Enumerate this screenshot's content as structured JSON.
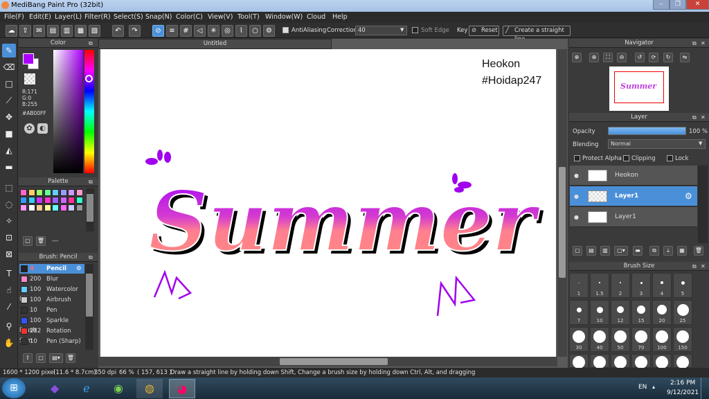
{
  "window": {
    "title": "MediBang Paint Pro (32bit)"
  },
  "menu": [
    "File(F)",
    "Edit(E)",
    "Layer(L)",
    "Filter(R)",
    "Select(S)",
    "Snap(N)",
    "Color(C)",
    "View(V)",
    "Tool(T)",
    "Window(W)",
    "Cloud",
    "Help"
  ],
  "toolbar": {
    "antialiasing": "AntiAliasing",
    "correction_label": "Correction",
    "correction_value": "40",
    "soft_edge": "Soft Edge",
    "key_label": "Key",
    "reset": "Reset",
    "straight_line": "Create a straight line"
  },
  "color_panel": {
    "title": "Color",
    "r": "R:171",
    "g": "G:0",
    "b": "B:255",
    "hex": "#AB00FF",
    "primary": "#AB00FF"
  },
  "palette_panel": {
    "title": "Palette",
    "swatches": [
      "#ff66cc",
      "#ffcc66",
      "#99ff66",
      "#66ff99",
      "#66ccff",
      "#9999ff",
      "#cc99ff",
      "#ff99cc",
      "#3399ff",
      "#33ccff",
      "#cc33ff",
      "#ff33cc",
      "#9966ff",
      "#cc66ff",
      "#ff3399",
      "#33ffcc",
      "#ff99ff",
      "#ffffff",
      "#ffcc99",
      "#ffff99",
      "#66ffff",
      "#ff66ff",
      "#ccccff",
      "#999999"
    ],
    "dash": "---"
  },
  "brush_panel": {
    "title": "Brush: Pencil",
    "items": [
      {
        "size": "4",
        "name": "Pencil",
        "color": "#222222",
        "selected": true
      },
      {
        "size": "200",
        "name": "Blur",
        "color": "#ff88cc"
      },
      {
        "size": "100",
        "name": "Watercolor (W",
        "color": "#66ccff"
      },
      {
        "size": "100",
        "name": "Airbrush",
        "color": "#cccccc"
      },
      {
        "size": "10",
        "name": "Pen",
        "color": "#333333"
      },
      {
        "size": "100",
        "name": "Sparkle Brush",
        "color": "#3355ff"
      },
      {
        "size": "282",
        "name": "Rotation Sym",
        "color": "#ee3333"
      },
      {
        "size": "10",
        "name": "Pen (Sharp)",
        "color": "#333333"
      }
    ]
  },
  "canvas": {
    "tab": "Untitled",
    "text1": "Heokon",
    "text2": "#Hoidap247",
    "art_word": "Summer"
  },
  "navigator": {
    "title": "Navigator"
  },
  "layer_panel": {
    "title": "Layer",
    "opacity_label": "Opacity",
    "opacity_value": "100 %",
    "opacity_fraction": 1.0,
    "blending_label": "Blending",
    "blending_value": "Normal",
    "protect_alpha": "Protect Alpha",
    "clipping": "Clipping",
    "lock": "Lock",
    "layers": [
      {
        "name": "Heokon",
        "selected": false
      },
      {
        "name": "Layer1",
        "selected": true
      },
      {
        "name": "Layer1",
        "selected": false
      }
    ]
  },
  "brush_size": {
    "title": "Brush Size",
    "sizes": [
      "1",
      "1.5",
      "2",
      "3",
      "4",
      "5",
      "7",
      "10",
      "12",
      "15",
      "20",
      "25",
      "30",
      "40",
      "50",
      "70",
      "100",
      "150"
    ]
  },
  "status": {
    "dims": "1600 * 1200 pixel",
    "cm": "(11.6 * 8.7cm)",
    "dpi": "350 dpi",
    "zoom": "66 %",
    "coords": "( 157, 613 )",
    "hint": "Draw a straight line by holding down Shift, Change a brush size by holding down Ctrl, Alt, and dragging"
  },
  "taskbar": {
    "lang": "EN",
    "time": "2:16 PM",
    "date": "9/12/2021"
  }
}
